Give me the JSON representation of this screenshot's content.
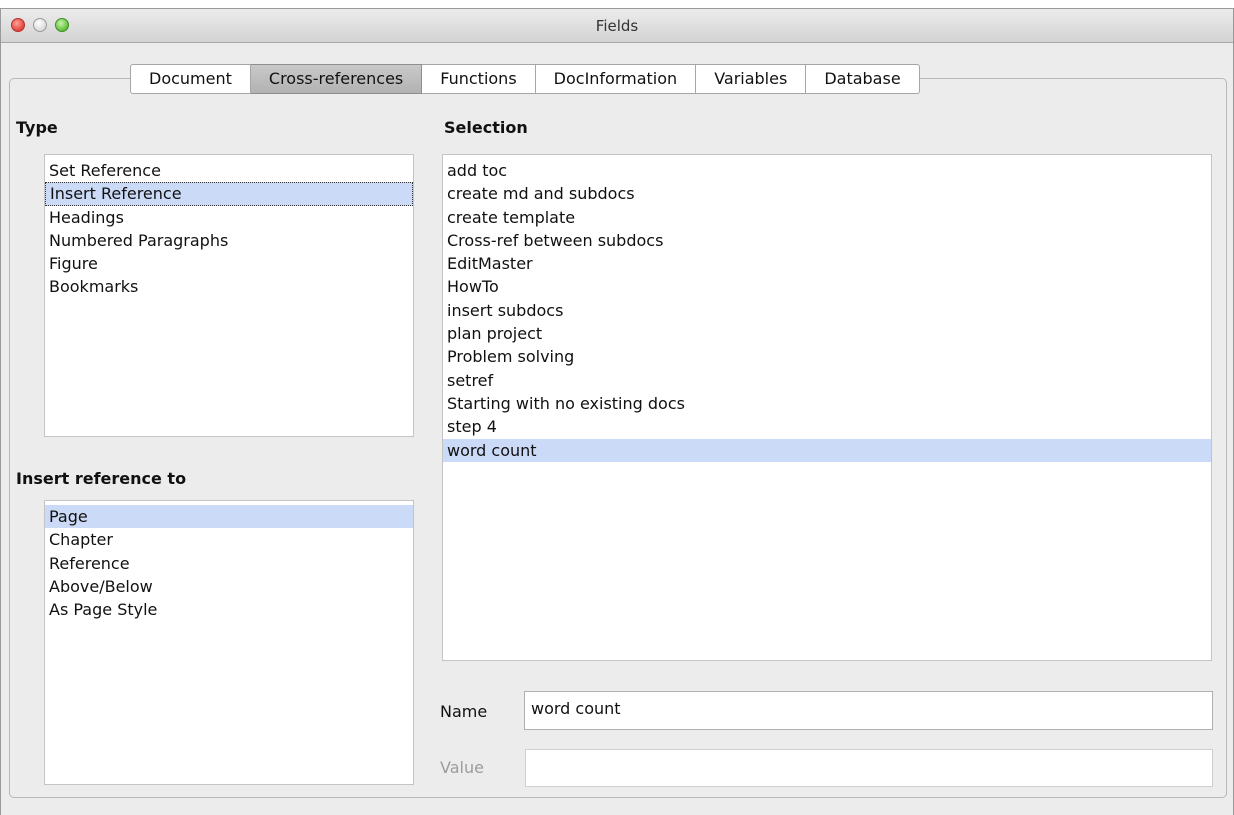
{
  "window": {
    "title": "Fields"
  },
  "tabs": [
    {
      "label": "Document"
    },
    {
      "label": "Cross-references"
    },
    {
      "label": "Functions"
    },
    {
      "label": "DocInformation"
    },
    {
      "label": "Variables"
    },
    {
      "label": "Database"
    }
  ],
  "active_tab": "Cross-references",
  "type": {
    "label": "Type",
    "items": [
      "Set Reference",
      "Insert Reference",
      "Headings",
      "Numbered Paragraphs",
      "Figure",
      "Bookmarks"
    ],
    "selected": "Insert Reference"
  },
  "insert_ref": {
    "label": "Insert reference to",
    "items": [
      "Page",
      "Chapter",
      "Reference",
      "Above/Below",
      "As Page Style"
    ],
    "selected": "Page"
  },
  "selection": {
    "label": "Selection",
    "items": [
      "add toc",
      "create md and subdocs",
      "create template",
      "Cross-ref between subdocs",
      "EditMaster",
      "HowTo",
      "insert subdocs",
      "plan project",
      "Problem solving",
      "setref",
      "Starting with no existing docs",
      "step 4",
      "word count"
    ],
    "selected": "word count"
  },
  "name_field": {
    "label": "Name",
    "value": "word count"
  },
  "value_field": {
    "label": "Value",
    "value": ""
  }
}
